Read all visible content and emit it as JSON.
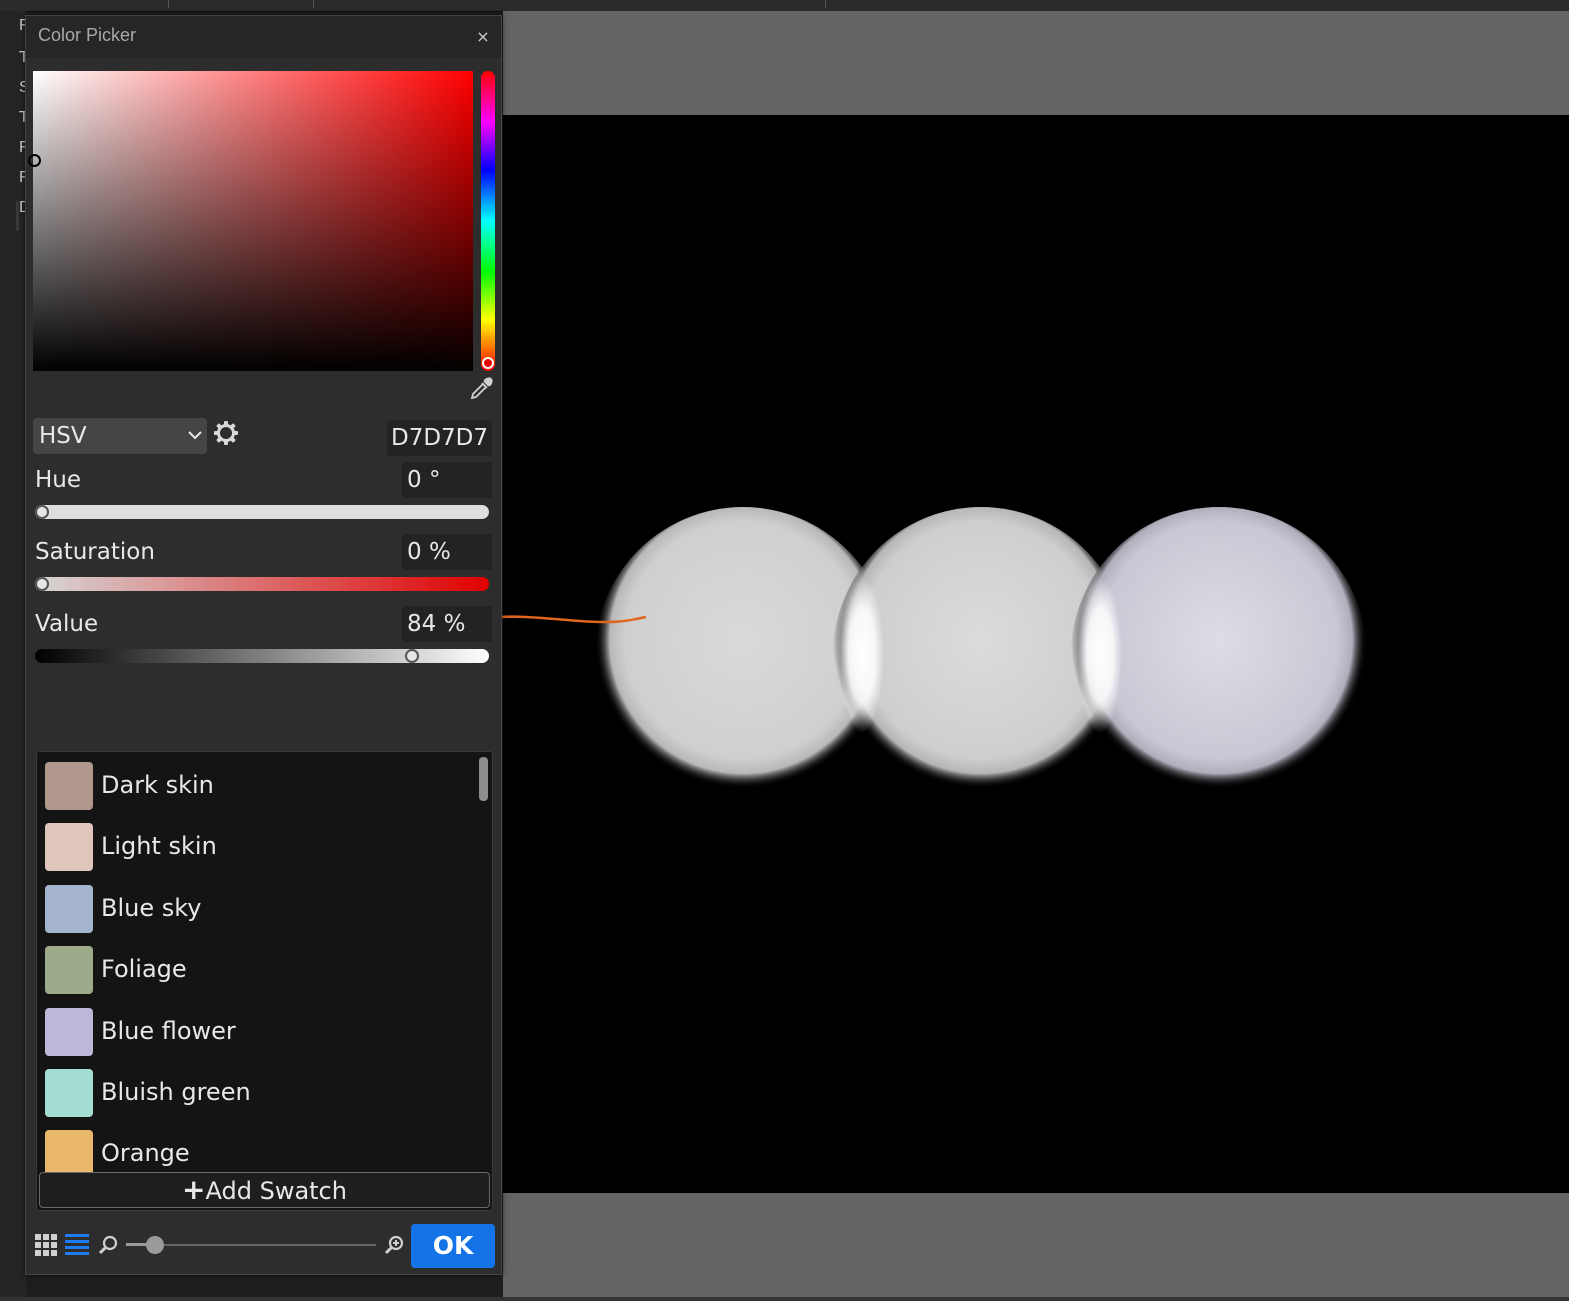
{
  "dialog": {
    "title": "Color Picker",
    "close_label": "×",
    "mode": "HSV",
    "hex": "D7D7D7",
    "channels": {
      "hue": {
        "label": "Hue",
        "value": "0 °",
        "fraction": 0.0
      },
      "saturation": {
        "label": "Saturation",
        "value": "0 %",
        "fraction": 0.0
      },
      "value": {
        "label": "Value",
        "value": "84 %",
        "fraction": 0.84
      }
    },
    "hue_color": "#ff0000",
    "swatches": [
      {
        "label": "Dark skin",
        "color": "#b1988c"
      },
      {
        "label": "Light skin",
        "color": "#dfc5bb"
      },
      {
        "label": "Blue sky",
        "color": "#a3b4cc"
      },
      {
        "label": "Foliage",
        "color": "#9dab8a"
      },
      {
        "label": "Blue flower",
        "color": "#bbb8d8"
      },
      {
        "label": "Bluish green",
        "color": "#a4ded2"
      },
      {
        "label": "Orange",
        "color": "#e9b86a"
      }
    ],
    "add_swatch_label": "Add Swatch",
    "add_swatch_icon": "plus-icon",
    "ok_label": "OK",
    "accent_color": "#1473e6"
  },
  "icons": {
    "eyedropper": "eyedropper-icon",
    "settings": "gear-icon",
    "grid_view": "grid-icon",
    "list_view": "list-icon",
    "zoom_out": "zoom-out-icon",
    "zoom_in": "zoom-in-icon"
  },
  "left_strip_letters": [
    "F",
    "T",
    "S",
    "T",
    "F",
    "F",
    "D"
  ]
}
